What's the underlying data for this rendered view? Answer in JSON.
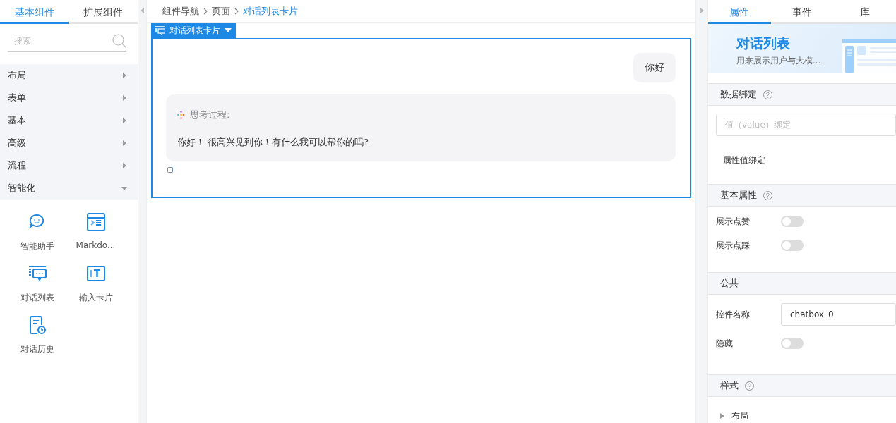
{
  "left_panel": {
    "tabs": [
      {
        "label": "基本组件",
        "selected": true
      },
      {
        "label": "扩展组件",
        "selected": false
      }
    ],
    "search": {
      "placeholder": "搜索"
    },
    "categories": [
      {
        "label": "布局",
        "expanded": false
      },
      {
        "label": "表单",
        "expanded": false
      },
      {
        "label": "基本",
        "expanded": false
      },
      {
        "label": "高级",
        "expanded": false
      },
      {
        "label": "流程",
        "expanded": false
      },
      {
        "label": "智能化",
        "expanded": true
      }
    ],
    "components": [
      {
        "kind": "assistant",
        "label": "智能助手"
      },
      {
        "kind": "markdown",
        "label": "Markdo..."
      },
      {
        "kind": "chatlist",
        "label": "对话列表"
      },
      {
        "kind": "inputcard",
        "label": "输入卡片"
      },
      {
        "kind": "history",
        "label": "对话历史"
      }
    ]
  },
  "breadcrumb": [
    {
      "label": "组件导航",
      "current": false
    },
    {
      "label": "页面",
      "current": false
    },
    {
      "label": "对话列表卡片",
      "current": true
    }
  ],
  "canvas": {
    "component_tag": "对话列表卡片",
    "messages": [
      {
        "kind": "user",
        "text": "你好"
      },
      {
        "kind": "assistant",
        "thinking_label": "思考过程:",
        "text": "你好！ 很高兴见到你！有什么我可以帮你的吗?"
      }
    ]
  },
  "right_panel": {
    "tabs": [
      {
        "label": "属性",
        "selected": true
      },
      {
        "label": "事件",
        "selected": false
      },
      {
        "label": "库",
        "selected": false
      }
    ],
    "banner": {
      "title": "对话列表",
      "description": "用来展示用户与大模..."
    },
    "sections": [
      {
        "title": "数据绑定",
        "help": true,
        "rows": [
          {
            "kind": "input",
            "placeholder": "值（value）绑定"
          },
          {
            "kind": "label",
            "label": "属性值绑定"
          }
        ]
      },
      {
        "title": "基本属性",
        "help": true,
        "rows": [
          {
            "kind": "switch",
            "label": "展示点赞",
            "on": false
          },
          {
            "kind": "switch",
            "label": "展示点踩",
            "on": false
          }
        ]
      },
      {
        "title": "公共",
        "help": false,
        "rows": [
          {
            "kind": "text_input",
            "label": "控件名称",
            "value": "chatbox_0"
          },
          {
            "kind": "switch",
            "label": "隐藏",
            "on": false
          }
        ]
      },
      {
        "title": "样式",
        "help": true,
        "rows": [
          {
            "kind": "collapse",
            "label": "布局",
            "expanded": false
          }
        ]
      }
    ]
  }
}
